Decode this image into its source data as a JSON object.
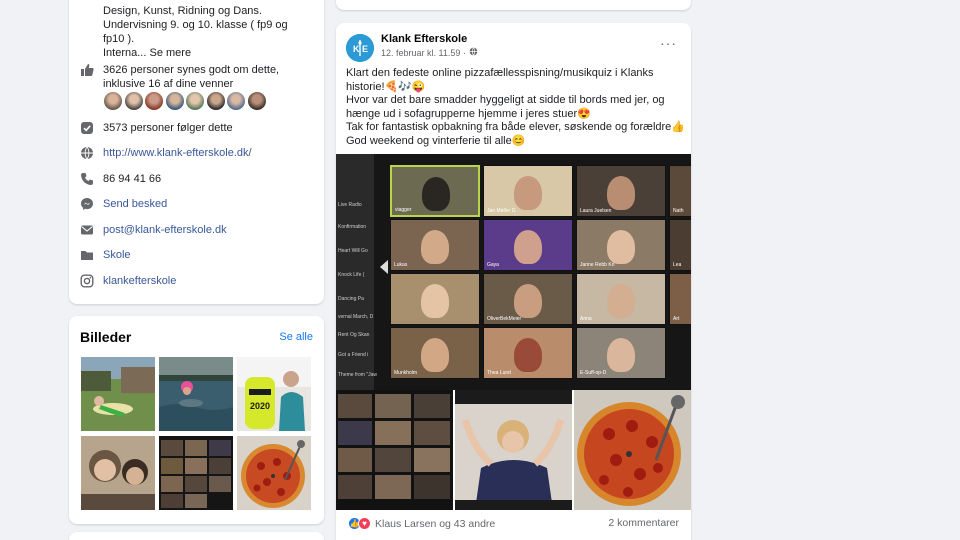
{
  "intro": {
    "lines": [
      "Design, Kunst, Ridning og Dans.",
      "Undervisning 9. og 10. klasse ( fp9 og",
      "fp10 )."
    ],
    "truncated": "Interna...",
    "see_more": "Se mere",
    "likes_line1": "3626 personer synes godt om dette,",
    "likes_line2": "inklusive 16 af dine venner",
    "followers": "3573 personer følger dette",
    "website": "http://www.klank-efterskole.dk/",
    "phone": "86 94 41 66",
    "send_message": "Send besked",
    "email": "post@klank-efterskole.dk",
    "category": "Skole",
    "instagram": "klankefterskole",
    "icons": [
      "thumbs-up-icon",
      "checkbox-icon",
      "globe-icon",
      "phone-icon",
      "messenger-icon",
      "mail-icon",
      "category-icon",
      "instagram-icon"
    ]
  },
  "photos": {
    "title": "Billeder",
    "see_all": "Se alle"
  },
  "post": {
    "page_name": "Klank Efterskole",
    "avatar_text": "K E",
    "time": "12. februar kl. 11.59 ·",
    "more": "···",
    "lines": [
      "Klart den fedeste online pizzafællesspisning/musikquiz i Klanks",
      "historie!🍕🎶😜",
      "Hvor var det bare smadder hyggeligt at sidde til bords med jer, og",
      "hænge ud i sofagrupperne hjemme i jeres stuer😍",
      "Tak for fantastisk opbakning fra både elever, søskende og forældre👍",
      "God weekend og vinterferie til alle😊"
    ],
    "zoom_sidebar": [
      "Live Radio",
      "Konfirmation",
      "Heart Will Go",
      "Knock Life (",
      "Dancing Pa",
      "vernal March, D",
      "Rent Og Skan",
      "Got a Friend i",
      "Theme from \"Jaw"
    ],
    "zoom_tiles": [
      "viagger",
      "Jan Møller G",
      "Laura Juelsen",
      "Nath",
      "Lukas",
      "Gaya",
      "Janne Rebb Kri",
      "Lea",
      "OliverBekMeier",
      "Anna",
      "Art",
      "Munkholm",
      "Thea Lund",
      "E-Suff-op-D"
    ],
    "reactions_text": "Klaus Larsen og 43 andre",
    "comments_text": "2 kommentarer",
    "badge_text": "2020"
  }
}
